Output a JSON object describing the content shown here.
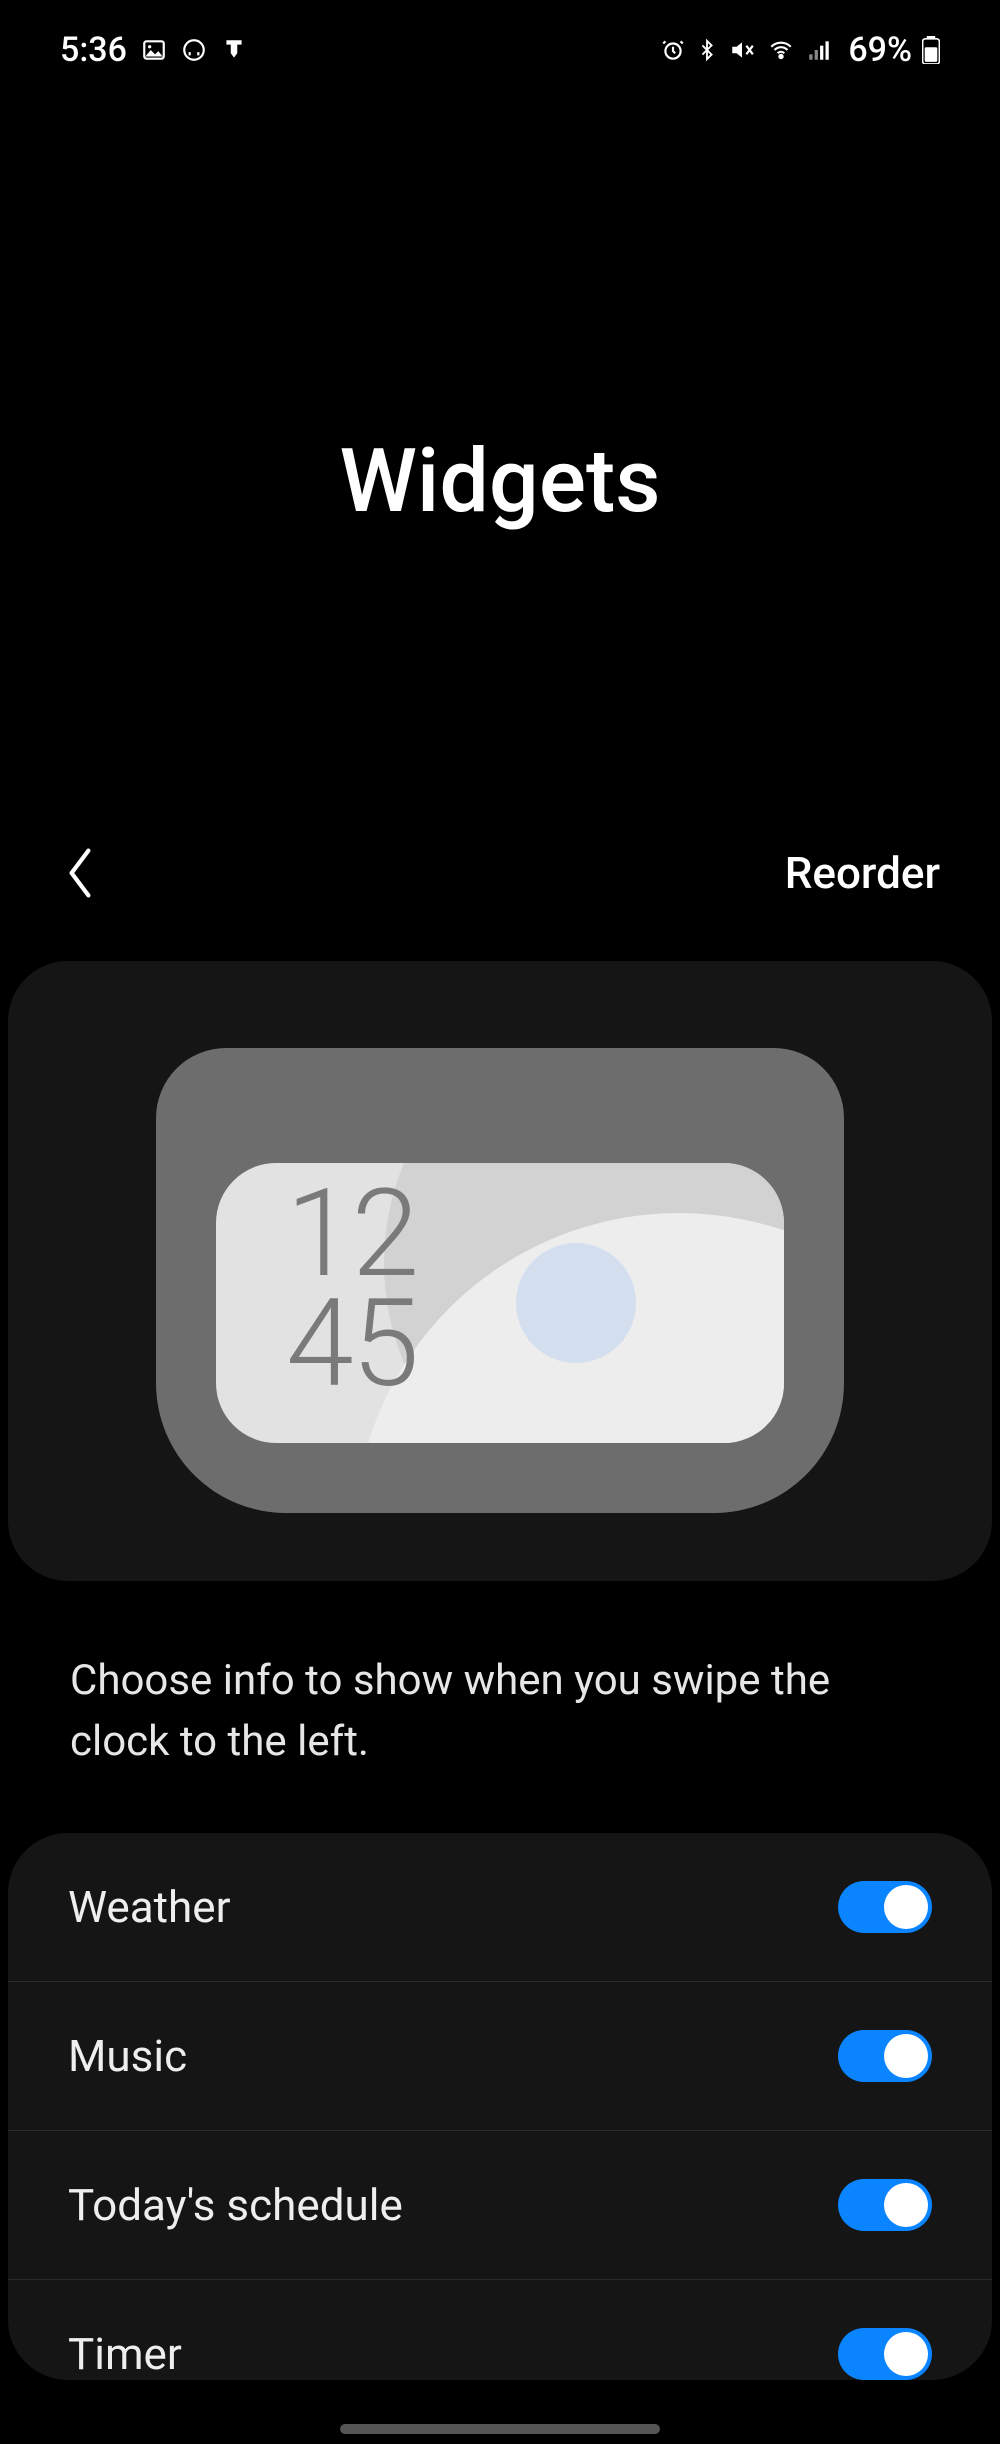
{
  "statusbar": {
    "time": "5:36",
    "battery_pct": "69%"
  },
  "page": {
    "title": "Widgets",
    "reorder_label": "Reorder",
    "description": "Choose info to show when you swipe the clock to the left."
  },
  "preview": {
    "clock_top": "12",
    "clock_bottom": "45"
  },
  "list": {
    "items": [
      {
        "label": "Weather",
        "enabled": true
      },
      {
        "label": "Music",
        "enabled": true
      },
      {
        "label": "Today's schedule",
        "enabled": true
      },
      {
        "label": "Timer",
        "enabled": true
      }
    ]
  }
}
